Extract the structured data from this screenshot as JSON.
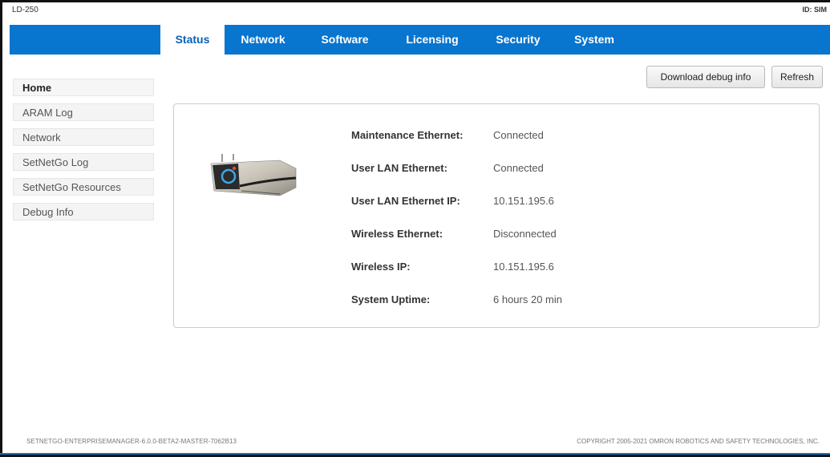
{
  "header": {
    "model": "LD-250",
    "device_id": "ID: SIM"
  },
  "nav": {
    "tabs": [
      "Status",
      "Network",
      "Software",
      "Licensing",
      "Security",
      "System"
    ],
    "active": "Status"
  },
  "sidebar": {
    "items": [
      "Home",
      "ARAM Log",
      "Network",
      "SetNetGo Log",
      "SetNetGo Resources",
      "Debug Info"
    ],
    "active": "Home"
  },
  "actions": {
    "download_label": "Download debug info",
    "refresh_label": "Refresh"
  },
  "status": {
    "rows": [
      {
        "label": "Maintenance Ethernet:",
        "value": "Connected"
      },
      {
        "label": "User LAN Ethernet:",
        "value": "Connected"
      },
      {
        "label": "User LAN Ethernet IP:",
        "value": "10.151.195.6"
      },
      {
        "label": "Wireless Ethernet:",
        "value": "Disconnected"
      },
      {
        "label": "Wireless IP:",
        "value": "10.151.195.6"
      },
      {
        "label": "System Uptime:",
        "value": "6 hours 20 min"
      }
    ]
  },
  "footer": {
    "version": "SETNETGO-ENTERPRISEMANAGER-6.0.0-BETA2-MASTER-7062B13",
    "copyright": "COPYRIGHT 2005-2021 OMRON ROBOTICS AND SAFETY TECHNOLOGIES, INC."
  },
  "colors": {
    "accent": "#0875cf",
    "active_tab_text": "#0b62b6"
  }
}
